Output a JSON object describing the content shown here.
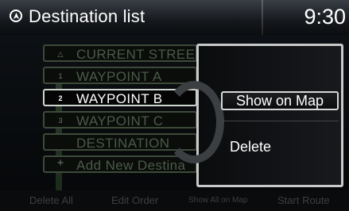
{
  "header": {
    "title": "Destination list",
    "time": "9:30",
    "icon": "navigation-icon"
  },
  "list": {
    "items": [
      {
        "num": "",
        "label": "CURRENT STREE",
        "icon": "triangle-icon",
        "selected": false
      },
      {
        "num": "1",
        "label": "WAYPOINT A",
        "selected": false
      },
      {
        "num": "2",
        "label": "WAYPOINT B",
        "selected": true
      },
      {
        "num": "3",
        "label": "WAYPOINT C",
        "selected": false
      },
      {
        "num": "",
        "label": "DESTINATION",
        "selected": false
      },
      {
        "num": "+",
        "label": "Add New Destina",
        "selected": false
      }
    ]
  },
  "popup": {
    "show_on_map": "Show on Map",
    "delete": "Delete"
  },
  "bottom": {
    "delete_all": "Delete All",
    "edit_order": "Edit Order",
    "show_all": "Show All on Map",
    "start_route": "Start Route"
  },
  "colors": {
    "background": "#000000",
    "active_border": "#cfd6cf",
    "inactive_text": "#4b5a48"
  }
}
